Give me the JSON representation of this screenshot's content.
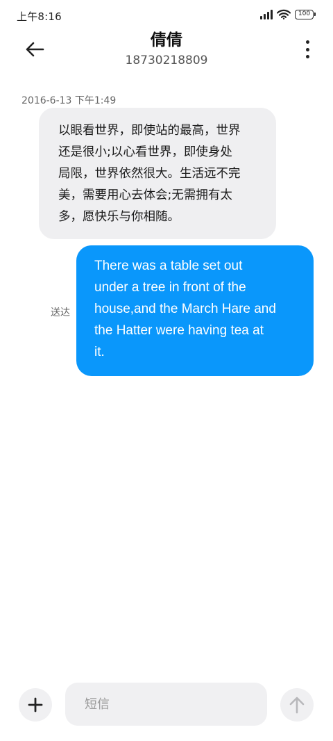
{
  "status_bar": {
    "time": "上午8:16",
    "battery": "100"
  },
  "header": {
    "contact_name": "倩倩",
    "contact_number": "18730218809"
  },
  "conversation": {
    "timestamp": "2016-6-13 下午1:49",
    "incoming": {
      "lines": [
        "以眼看世界，即使站的最高，世界",
        "还是很小;以心看世界，即使身处",
        "局限，世界依然很大。生活远不完",
        "美，需要用心去体会;无需拥有太",
        "多，愿快乐与你相随。"
      ]
    },
    "outgoing": {
      "lines": [
        "There was a table set out",
        "under a tree in front of the",
        "house,and the March Hare and",
        "the Hatter were having tea at",
        "it."
      ],
      "status": "送达"
    }
  },
  "composer": {
    "placeholder": "短信",
    "value": ""
  },
  "icons": {
    "back": "arrow-left-icon",
    "more": "more-vertical-icon",
    "add": "plus-icon",
    "send": "arrow-up-icon",
    "signal": "signal-icon",
    "wifi": "wifi-icon",
    "battery": "battery-icon"
  },
  "colors": {
    "outgoing_bubble": "#0a97fb",
    "incoming_bubble": "#efeff1",
    "composer_bg": "#f0f0f2"
  }
}
